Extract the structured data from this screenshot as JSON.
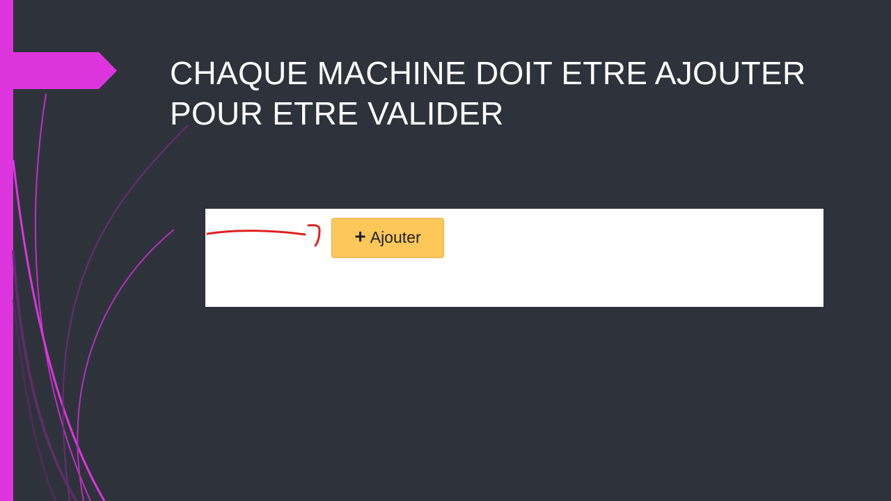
{
  "slide": {
    "title": "CHAQUE MACHINE DOIT ETRE AJOUTER POUR ETRE VALIDER",
    "accent_color": "#dd35de",
    "background_color": "#2e333b"
  },
  "screenshot": {
    "add_button": {
      "icon": "plus-icon",
      "icon_glyph": "+",
      "label": "Ajouter",
      "color": "#fdc75a"
    },
    "annotation_color": "#e0201c"
  }
}
